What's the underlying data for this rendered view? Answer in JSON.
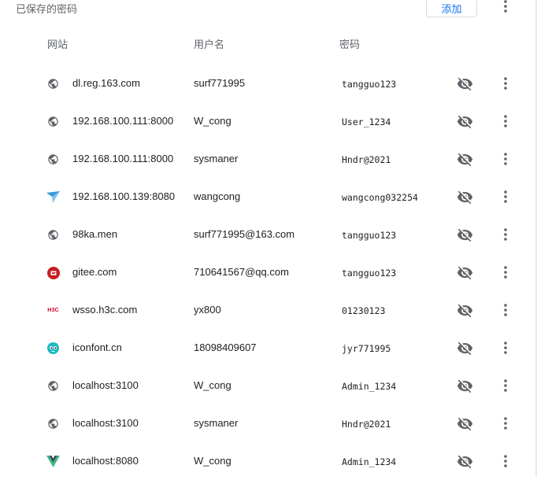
{
  "header": {
    "title": "已保存的密码",
    "add_label": "添加"
  },
  "columns": {
    "site": "网站",
    "username": "用户名",
    "password": "密码"
  },
  "rows": [
    {
      "site": "dl.reg.163.com",
      "username": "surf771995",
      "password": "tangguo123",
      "icon": "globe-icon"
    },
    {
      "site": "192.168.100.111:8000",
      "username": "W_cong",
      "password": "User_1234",
      "icon": "globe-icon"
    },
    {
      "site": "192.168.100.111:8000",
      "username": "sysmaner",
      "password": "Hndr@2021",
      "icon": "globe-icon"
    },
    {
      "site": "192.168.100.139:8080",
      "username": "wangcong",
      "password": "wangcong032254",
      "icon": "paper-plane-icon"
    },
    {
      "site": "98ka.men",
      "username": "surf771995@163.com",
      "password": "tangguo123",
      "icon": "globe-icon"
    },
    {
      "site": "gitee.com",
      "username": "710641567@qq.com",
      "password": "tangguo123",
      "icon": "gitee-logo-icon"
    },
    {
      "site": "wsso.h3c.com",
      "username": "yx800",
      "password": "01230123",
      "icon": "h3c-logo-icon"
    },
    {
      "site": "iconfont.cn",
      "username": "18098409607",
      "password": "jyr771995",
      "icon": "iconfont-logo-icon"
    },
    {
      "site": "localhost:3100",
      "username": "W_cong",
      "password": "Admin_1234",
      "icon": "globe-icon"
    },
    {
      "site": "localhost:3100",
      "username": "sysmaner",
      "password": "Hndr@2021",
      "icon": "globe-icon"
    },
    {
      "site": "localhost:8080",
      "username": "W_cong",
      "password": "Admin_1234",
      "icon": "vue-logo-icon"
    }
  ],
  "logo_text": {
    "h3c": "H3C"
  },
  "colors": {
    "accent": "#1a73e8",
    "icon_gray": "#5f6368",
    "gitee_red": "#c71d23",
    "h3c_red": "#d4002c",
    "iconfont_teal": "#1eb9c3",
    "vue_green": "#41b883",
    "vue_dark": "#35495e"
  }
}
